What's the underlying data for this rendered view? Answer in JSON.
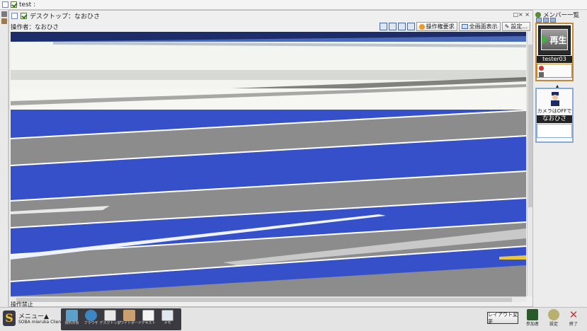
{
  "window": {
    "title": "test :"
  },
  "panel": {
    "title": "デスクトップ：なおひさ",
    "controls": "□× ×",
    "operator_label": "操作者：なおひさ",
    "status": "操作禁止"
  },
  "toolbar": {
    "request_control": "操作権要求",
    "fullscreen": "全画面表示",
    "settings": "設定..."
  },
  "members": {
    "title": "メンバー一覧",
    "play_label": "再生",
    "member1_name": "tester03",
    "member2_camera": "カメラはOFFです。",
    "member2_name": "なおひさ"
  },
  "taskbar": {
    "menu_label": "メニュー▲",
    "app_version": "SOBA mieruka Client 1.2.7",
    "tools": [
      {
        "label": "資料共有",
        "color": "#5aa0c8"
      },
      {
        "label": "ブラウザ",
        "color": "#3f87c4"
      },
      {
        "label": "デスクトップ",
        "color": "#e8e8e8"
      },
      {
        "label": "ホワイトボード",
        "color": "#caa070"
      },
      {
        "label": "テキスト",
        "color": "#f4f4f4"
      },
      {
        "label": "メモ",
        "color": "#dfe8f0"
      }
    ],
    "layout_change": "レイアウト変更",
    "members_btn": "参加者",
    "settings_btn": "設定",
    "exit_btn": "終了"
  },
  "colors": {
    "accent": "#3550c8",
    "screen_gray": "#8c8c8c"
  }
}
